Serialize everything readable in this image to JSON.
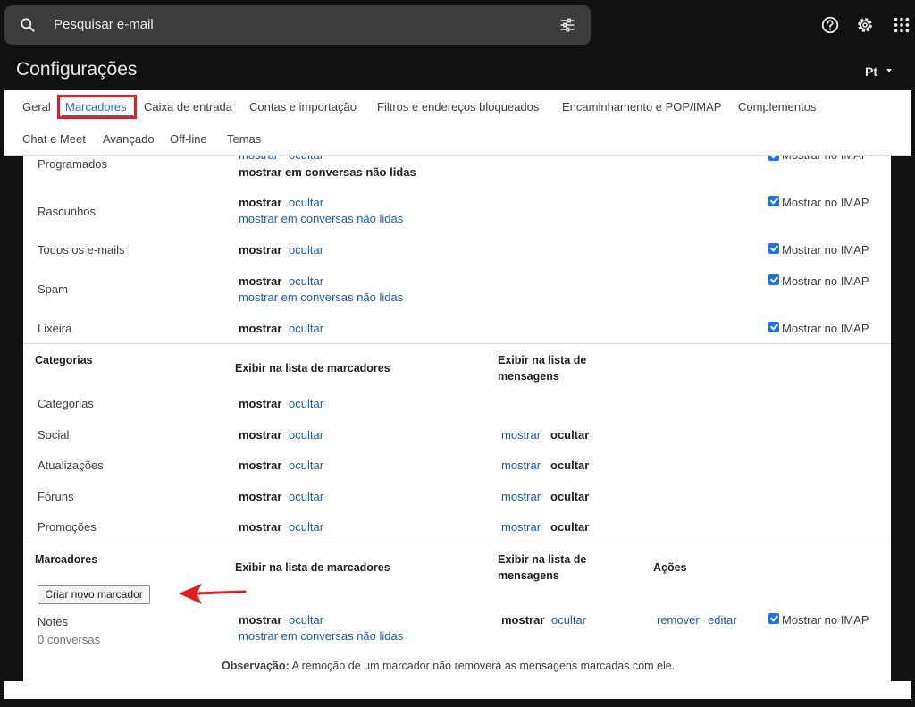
{
  "search": {
    "placeholder": "Pesquisar e-mail"
  },
  "header": {
    "title": "Configurações",
    "language": "Pt"
  },
  "tabs": [
    {
      "label": "Geral"
    },
    {
      "label": "Marcadores",
      "active": true
    },
    {
      "label": "Caixa de entrada"
    },
    {
      "label": "Contas e importação"
    },
    {
      "label": "Filtros e endereços bloqueados"
    },
    {
      "label": "Encaminhamento e POP/IMAP"
    },
    {
      "label": "Complementos"
    },
    {
      "label": "Chat e Meet"
    },
    {
      "label": "Avançado"
    },
    {
      "label": "Off-line"
    },
    {
      "label": "Temas"
    }
  ],
  "common": {
    "show": "mostrar",
    "hide": "ocultar",
    "show_unread": "mostrar em conversas não lidas",
    "imap": "Mostrar no IMAP",
    "remove": "remover",
    "edit": "editar"
  },
  "system_labels": [
    {
      "name": "Programados"
    },
    {
      "name": "Rascunhos"
    },
    {
      "name": "Todos os e-mails"
    },
    {
      "name": "Spam"
    },
    {
      "name": "Lixeira"
    }
  ],
  "categories": {
    "heading": "Categorias",
    "col_label_list": "Exibir na lista de marcadores",
    "col_message_list": "Exibir na lista de mensagens",
    "items": [
      {
        "name": "Categorias"
      },
      {
        "name": "Social"
      },
      {
        "name": "Atualizações"
      },
      {
        "name": "Fóruns"
      },
      {
        "name": "Promoções"
      }
    ]
  },
  "labels": {
    "heading": "Marcadores",
    "col_label_list": "Exibir na lista de marcadores",
    "col_message_list": "Exibir na lista de mensagens",
    "col_actions": "Ações",
    "create_button": "Criar novo marcador",
    "items": [
      {
        "name": "Notes",
        "count": "0 conversas"
      }
    ]
  },
  "note": {
    "bold": "Observação:",
    "text": "A remoção de um marcador não removerá as mensagens marcadas com ele."
  },
  "colors": {
    "accent": "#1a73e8",
    "highlight": "#e51c23",
    "link": "#1a5bbf"
  }
}
